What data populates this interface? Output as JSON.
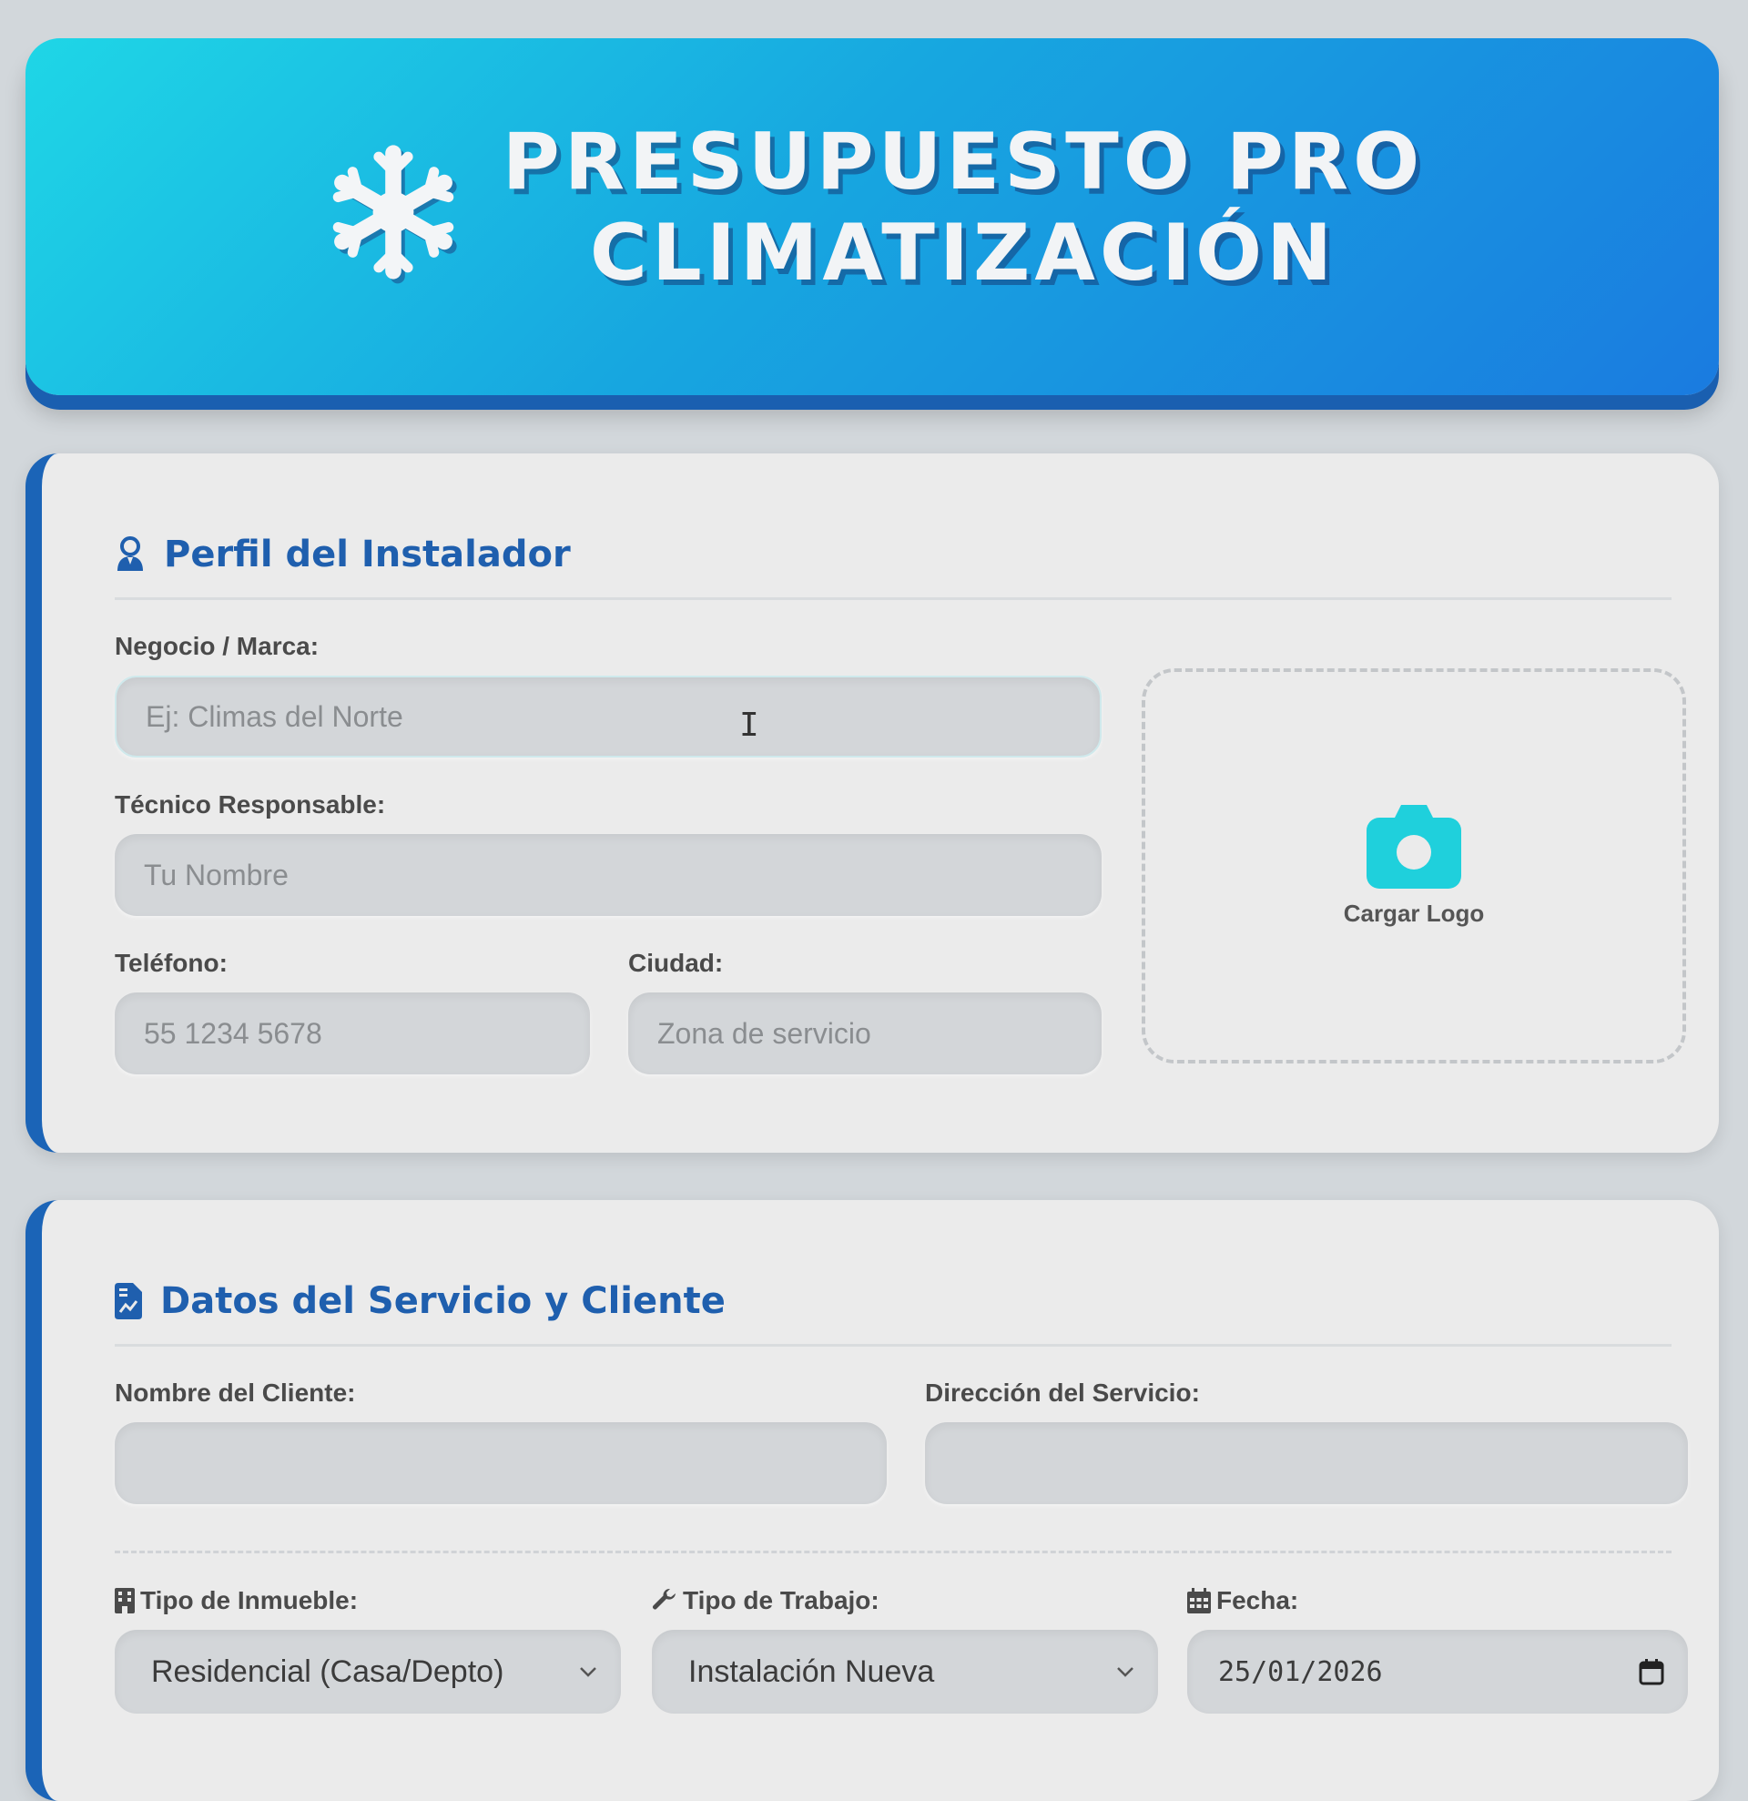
{
  "header": {
    "title_line1": "PRESUPUESTO PRO",
    "title_line2": "CLIMATIZACIÓN",
    "icon": "snowflake-icon"
  },
  "installer": {
    "section_title": "Perfil del Instalador",
    "icon": "user-tie-icon",
    "business_label": "Negocio / Marca:",
    "business_placeholder": "Ej: Climas del Norte",
    "tech_label": "Técnico Responsable:",
    "tech_placeholder": "Tu Nombre",
    "phone_label": "Teléfono:",
    "phone_placeholder": "55 1234 5678",
    "city_label": "Ciudad:",
    "city_placeholder": "Zona de servicio",
    "logo_label": "Cargar Logo",
    "logo_icon": "camera-icon",
    "logo_color": "#1fd0dc"
  },
  "service": {
    "section_title": "Datos del Servicio y Cliente",
    "icon": "file-invoice-icon",
    "client_label": "Nombre del Cliente:",
    "client_value": "",
    "address_label": "Dirección del Servicio:",
    "address_value": "",
    "property_label": "Tipo de Inmueble:",
    "property_value": "Residencial (Casa/Depto)",
    "work_label": "Tipo de Trabajo:",
    "work_value": "Instalación Nueva",
    "date_label": "Fecha:",
    "date_value": "25/01/2026"
  },
  "colors": {
    "accent": "#1b64b7",
    "header_start": "#1fd6e6",
    "header_end": "#1a7be0"
  }
}
